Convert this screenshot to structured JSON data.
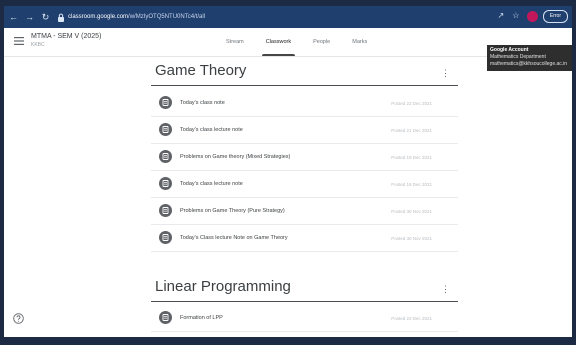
{
  "browser": {
    "url_host": "classroom.google.com",
    "url_path": "/w/MzIyOTQ5NTU0NTc4/t/all",
    "error_label": "Error"
  },
  "tooltip": {
    "title": "Google Account",
    "name": "Mathematics Department",
    "email": "mathematics@kkhsoucollege.ac.in"
  },
  "header": {
    "class_title": "MTMA - SEM V (2025)",
    "class_sub": "KKBC",
    "tabs": [
      {
        "label": "Stream"
      },
      {
        "label": "Classwork"
      },
      {
        "label": "People"
      },
      {
        "label": "Marks"
      }
    ]
  },
  "sections": [
    {
      "title": "Game Theory",
      "items": [
        {
          "label": "Today's class note",
          "date": "Posted 23 Dec 2021"
        },
        {
          "label": "Today's class lecture note",
          "date": "Posted 21 Dec 2021"
        },
        {
          "label": "Problems on Game theory (Mixed Strategies)",
          "date": "Posted 18 Dec 2021"
        },
        {
          "label": "Today's class lecture note",
          "date": "Posted 18 Dec 2021"
        },
        {
          "label": "Problems on Game Theory (Pure Strategy)",
          "date": "Posted 30 Nov 2021"
        },
        {
          "label": "Today's Class lecture Note on Game Theory",
          "date": "Posted 30 Nov 2021"
        }
      ]
    },
    {
      "title": "Linear Programming",
      "items": [
        {
          "label": "Formation of LPP",
          "date": "Posted 23 Dec 2021"
        }
      ]
    }
  ],
  "colors": {
    "browser_bar": "#1f3f6e",
    "text_primary": "#3c4043",
    "active_tab_indicator": "#444746",
    "avatar": "#c2185b"
  },
  "icons": {
    "back": "arrow-left-icon",
    "forward": "arrow-right-icon",
    "reload": "reload-icon",
    "menu": "hamburger-menu-icon",
    "assignment": "document-icon",
    "more": "more-vert-icon",
    "help": "help-icon"
  }
}
